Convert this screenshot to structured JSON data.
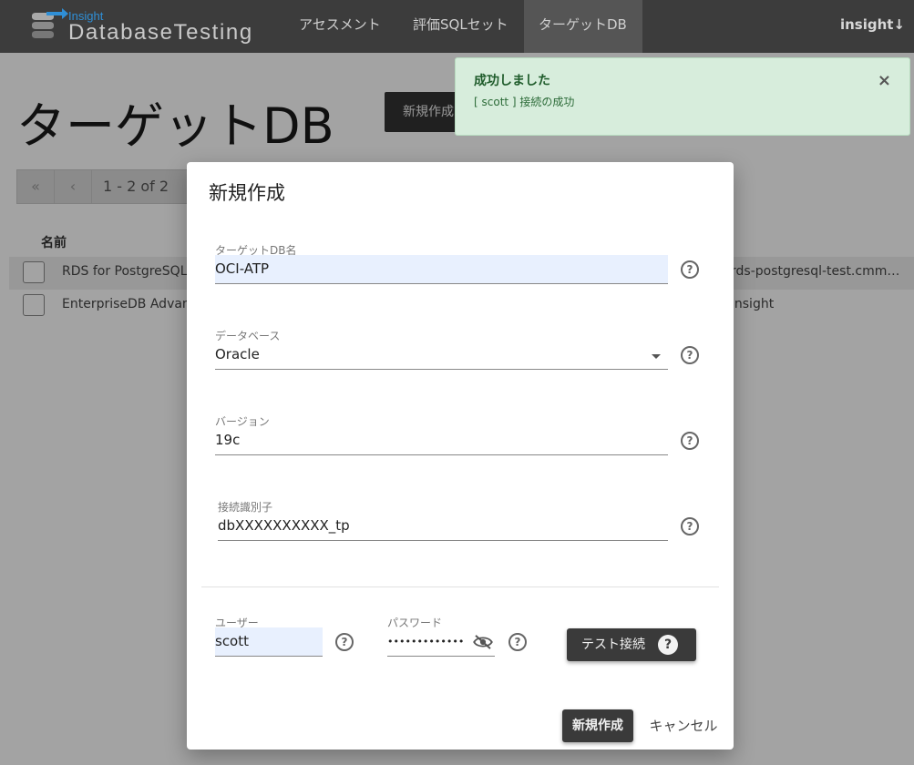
{
  "nav": {
    "logo_small": "Insight",
    "logo_big": "DatabaseTesting",
    "items": [
      {
        "label": "アセスメント"
      },
      {
        "label": "評価SQLセット"
      },
      {
        "label": "ターゲットDB"
      }
    ],
    "user": "insight↓"
  },
  "page": {
    "title": "ターゲットDB",
    "create_label": "新規作成",
    "pager": {
      "first": "«",
      "prev": "‹",
      "info": "1 - 2  of  2"
    },
    "table": {
      "header_name": "名前",
      "rows": [
        {
          "name": "RDS for PostgreSQL",
          "host": "rds-postgresql-test.cmm…"
        },
        {
          "name": "EnterpriseDB Advanc",
          "host": "insight"
        }
      ]
    }
  },
  "toast": {
    "title": "成功しました",
    "message": "[ scott ] 接続の成功",
    "close": "×"
  },
  "modal": {
    "title": "新規作成",
    "fields": {
      "name": {
        "label": "ターゲットDB名",
        "value": "OCI-ATP"
      },
      "database": {
        "label": "データベース",
        "value": "Oracle"
      },
      "version": {
        "label": "バージョン",
        "value": "19c"
      },
      "connect_id": {
        "label": "接続識別子",
        "value": "dbXXXXXXXXXX_tp"
      },
      "user": {
        "label": "ユーザー",
        "value": "scott"
      },
      "password": {
        "label": "パスワード",
        "value": "•••••••••••••"
      }
    },
    "help_glyph": "?",
    "test_label": "テスト接続",
    "create_label": "新規作成",
    "cancel_label": "キャンセル"
  },
  "colors": {
    "navbar": "#3c3c3c",
    "accent": "#2f8fd6",
    "toast_bg": "#d7eddc",
    "button_dark": "#3a3a3a",
    "autofill": "#e8f0fe"
  }
}
